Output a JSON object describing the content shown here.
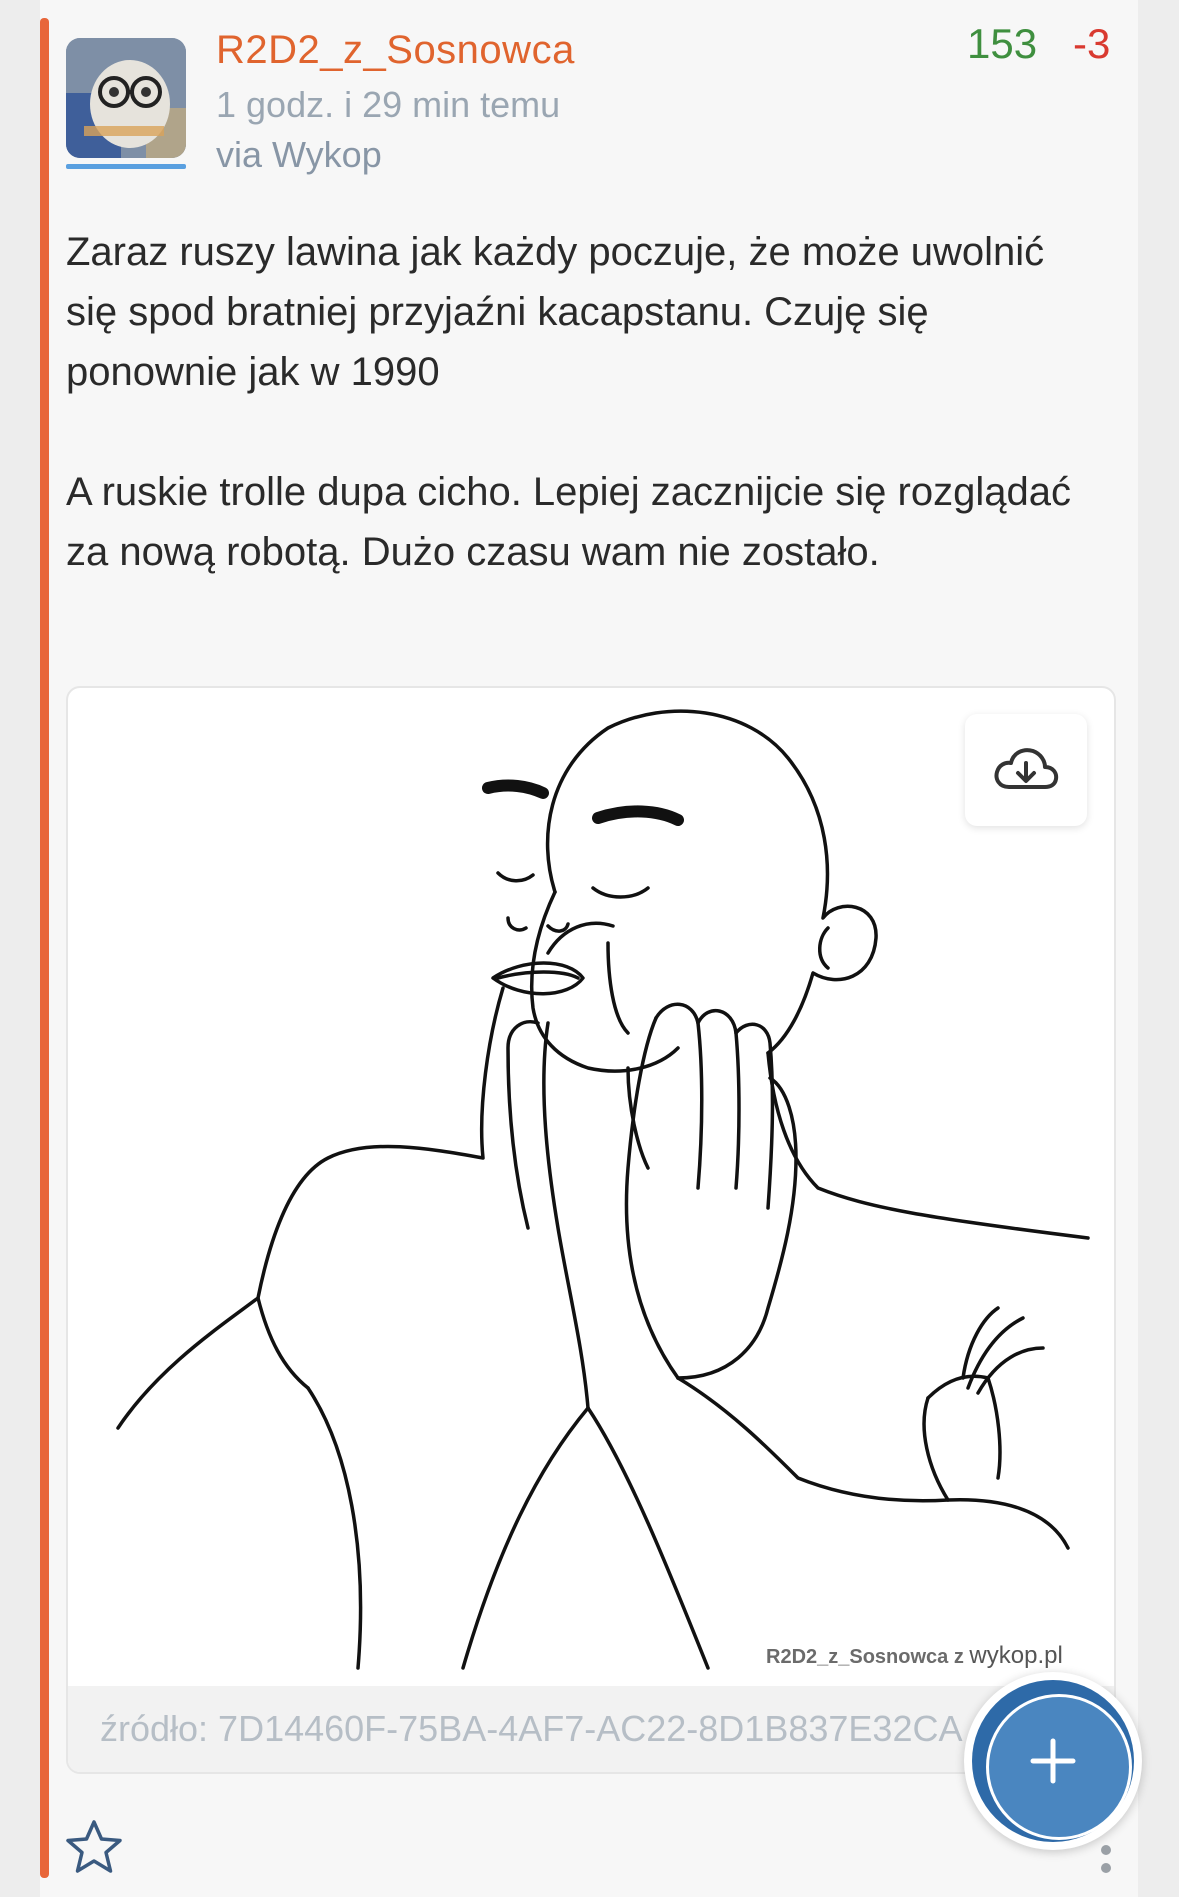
{
  "post": {
    "author": "R2D2_z_Sosnowca",
    "timestamp": "1 godz. i 29 min temu",
    "via": "via Wykop",
    "votes_up": "153",
    "votes_down": "-3",
    "paragraphs": [
      "Zaraz ruszy lawina jak każdy poczuje, że może uwolnić się spod bratniej przyjaźni kacapstanu. Czuję się ponownie jak w 1990",
      "A ruskie trolle dupa cicho. Lepiej zacznijcie się rozglądać za nową robotą. Dużo czasu wam nie zostało."
    ],
    "embed": {
      "watermark_author": "R2D2_z_Sosnowca z",
      "watermark_brand": "wykop.pl",
      "source": "źródło: 7D14460F-75BA-4AF7-AC22-8D1B837E32CA"
    }
  },
  "icons": {
    "download": "cloud-download-icon",
    "favorite": "star-icon",
    "more": "more-vertical-icon",
    "add": "plus-icon"
  },
  "colors": {
    "accent": "#e8663a",
    "username": "#e0642e",
    "vote_up": "#3f8f3f",
    "vote_down": "#d93a30",
    "fab": "#2e6aa8"
  }
}
